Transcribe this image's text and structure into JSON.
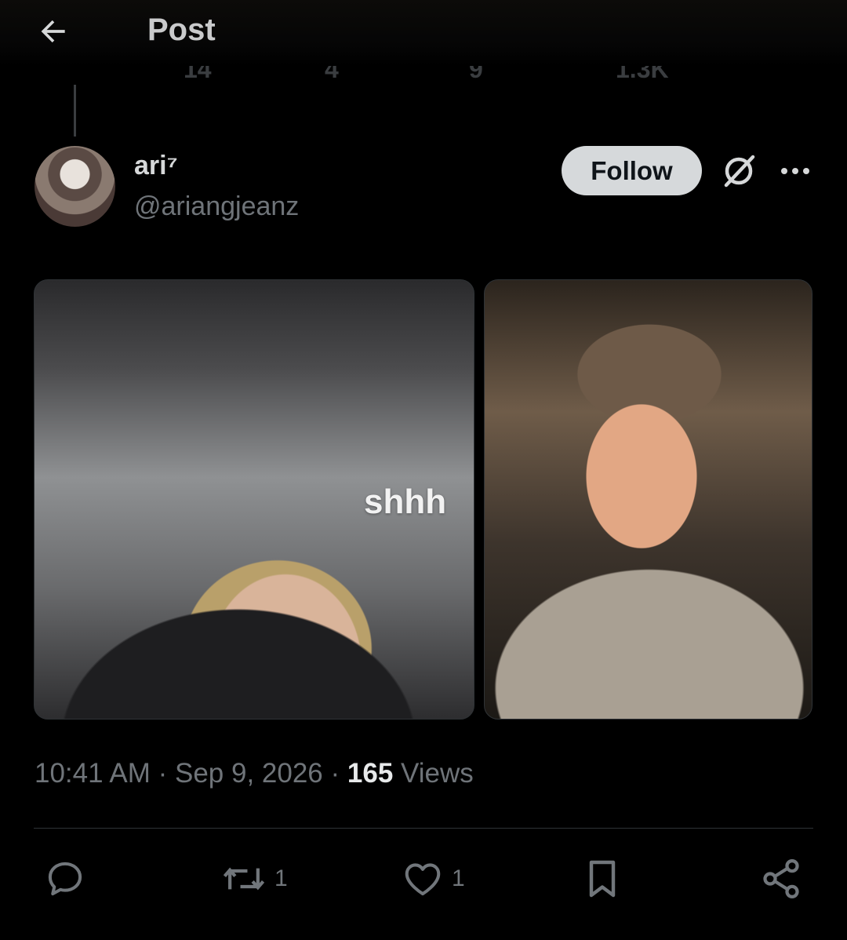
{
  "header": {
    "title": "Post"
  },
  "author": {
    "name": "ari⁷",
    "handle": "@ariangjeanz",
    "follow_label": "Follow"
  },
  "media": {
    "left_caption": "shhh"
  },
  "meta": {
    "time": "10:41 AM",
    "date": "Sep 9, 2026",
    "separator": " · ",
    "views_count": "165",
    "views_label": "Views"
  },
  "actions": {
    "reply_count": "",
    "repost_count": "1",
    "like_count": "1"
  },
  "previous_post_actions": {
    "reply_count": "14",
    "repost_count": "4",
    "like_count": "9",
    "views_count": "1.3K"
  }
}
